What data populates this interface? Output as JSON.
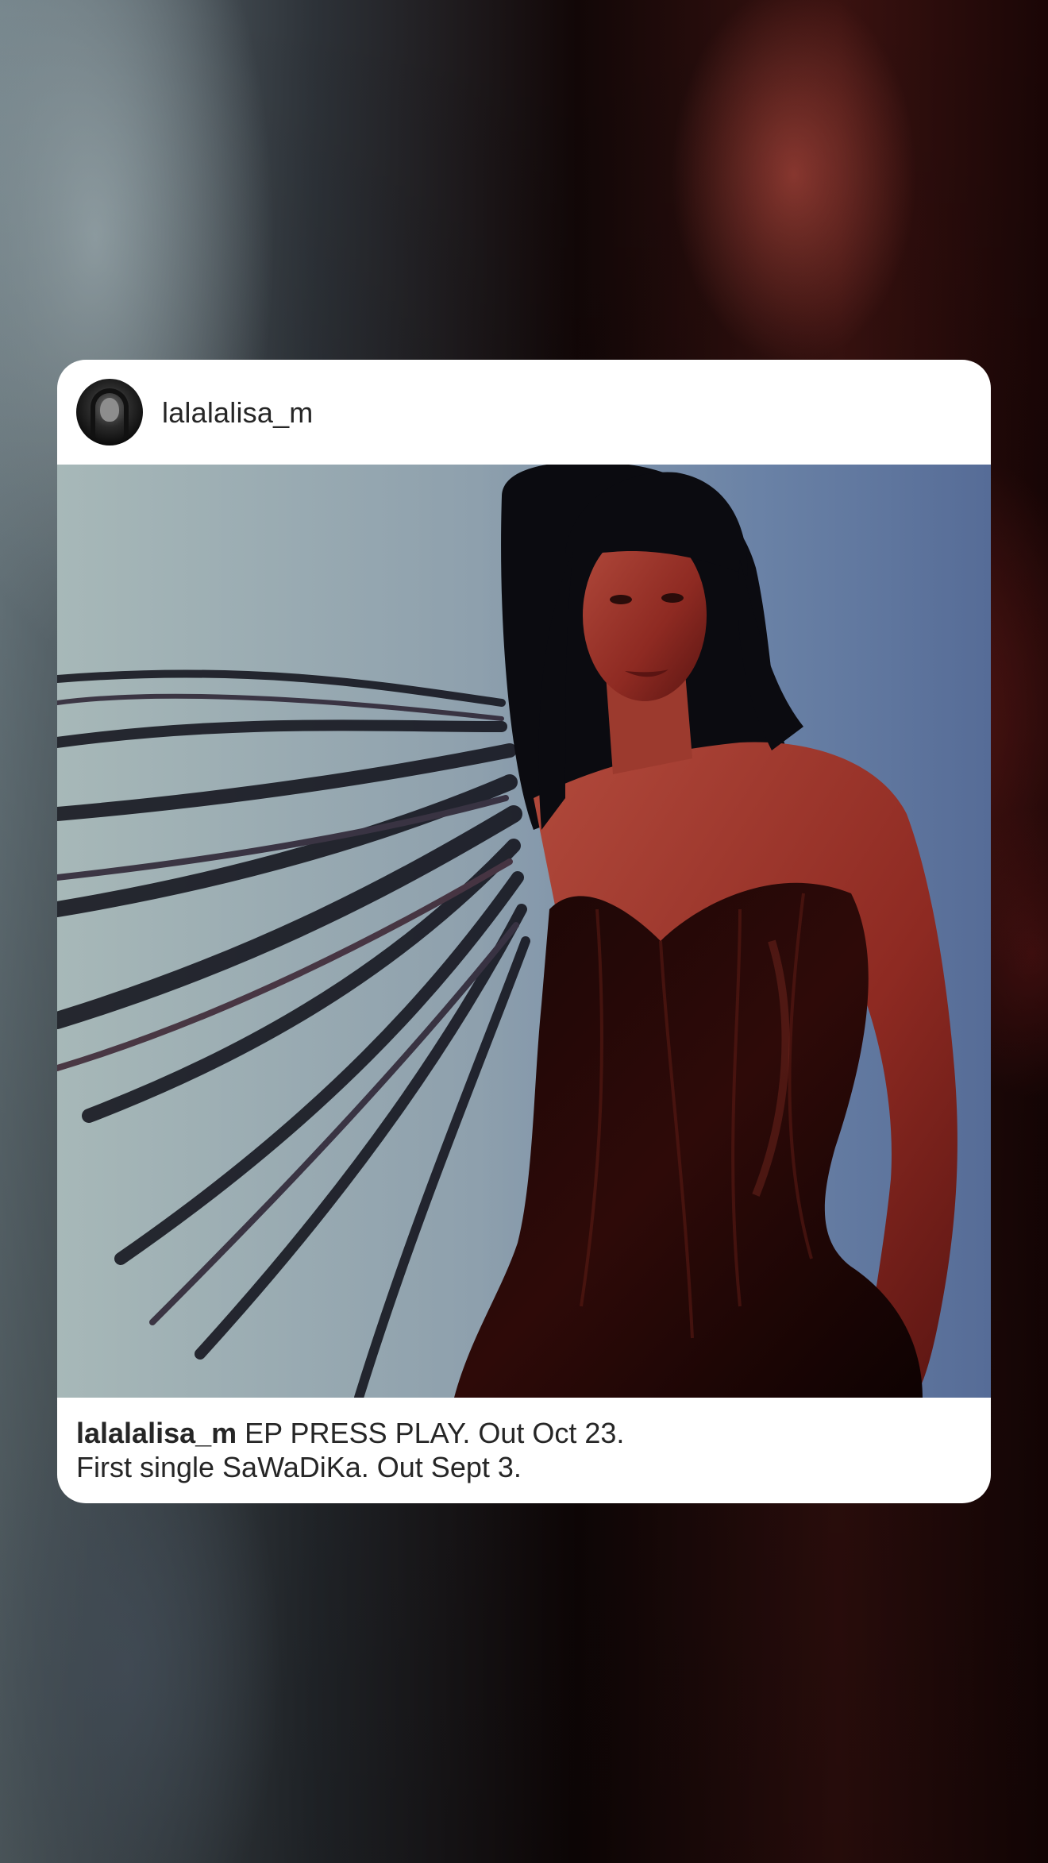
{
  "post": {
    "username": "lalalalisa_m",
    "caption_user": "lalalalisa_m",
    "caption_line1": "EP PRESS PLAY. Out Oct 23.",
    "caption_line2": "First single SaWaDiKa. Out Sept 3."
  },
  "colors": {
    "card_background": "#ffffff",
    "text": "#262626"
  }
}
